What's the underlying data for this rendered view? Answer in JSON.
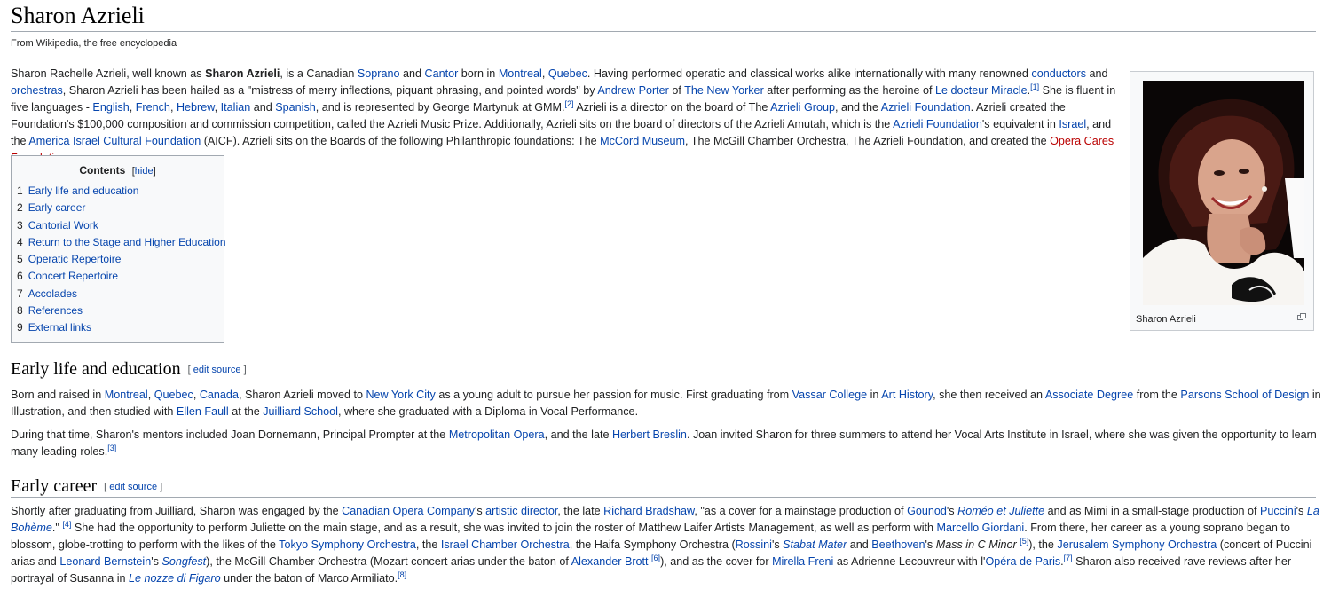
{
  "title": "Sharon Azrieli",
  "tagline": "From Wikipedia, the free encyclopedia",
  "infobox": {
    "caption": "Sharon Azrieli",
    "enlarge_icon": "magnify-clip-icon"
  },
  "toc": {
    "title": "Contents",
    "hide_label": "hide",
    "items": [
      {
        "num": "1",
        "label": "Early life and education"
      },
      {
        "num": "2",
        "label": "Early career"
      },
      {
        "num": "3",
        "label": "Cantorial Work"
      },
      {
        "num": "4",
        "label": "Return to the Stage and Higher Education"
      },
      {
        "num": "5",
        "label": "Operatic Repertoire"
      },
      {
        "num": "6",
        "label": "Concert Repertoire"
      },
      {
        "num": "7",
        "label": "Accolades"
      },
      {
        "num": "8",
        "label": "References"
      },
      {
        "num": "9",
        "label": "External links"
      }
    ]
  },
  "intro": {
    "t1": "Sharon Rachelle Azrieli, well known as ",
    "bold_name": "Sharon Azrieli",
    "t2": ", is a Canadian ",
    "l_soprano": "Soprano",
    "t3": " and ",
    "l_cantor": "Cantor",
    "t4": " born in ",
    "l_montreal": "Montreal",
    "t5": ", ",
    "l_quebec": "Quebec",
    "t6": ". Having performed operatic and classical works alike internationally with many renowned ",
    "l_conductors": "conductors",
    "t7": " and ",
    "l_orchestras": "orchestras",
    "t8": ", Sharon Azrieli has been hailed as a \"mistress of merry inflections, piquant phrasing, and pointed words\" by ",
    "l_porter": "Andrew Porter",
    "t9": " of ",
    "l_newyorker": "The New Yorker",
    "t10": " after performing as the heroine of ",
    "l_ledocteur": "Le docteur Miracle",
    "t11": ".",
    "ref1": "[1]",
    "t12": " She is fluent in five languages - ",
    "l_english": "English",
    "t13": ", ",
    "l_french": "French",
    "t14": ", ",
    "l_hebrew": "Hebrew",
    "t15": ", ",
    "l_italian": "Italian",
    "t16": " and ",
    "l_spanish": "Spanish",
    "t17": ", and is represented by George Martynuk at GMM.",
    "ref2": "[2]",
    "t18": " Azrieli is a director on the board of The ",
    "l_group": "Azrieli Group",
    "t19": ", and the ",
    "l_foundation": "Azrieli Foundation",
    "t20": ". Azrieli created the Foundation's $100,000 composition and commission competition, called the Azrieli Music Prize. Additionally, Azrieli sits on the board of directors of the Azrieli Amutah, which is the ",
    "l_foundation2": "Azrieli Foundation",
    "t21": "'s equivalent in ",
    "l_israel": "Israel",
    "t22": ", and the ",
    "l_aicf": "America Israel Cultural Foundation",
    "t23": " (AICF). Azrieli sits on the Boards of the following Philanthropic foundations: The ",
    "l_mccord": "McCord Museum",
    "t24": ", The McGill Chamber Orchestra, The Azrieli Foundation, and created the ",
    "l_operacares": "Opera Cares Foundation",
    "t25": "."
  },
  "sec1": {
    "heading": "Early life and education",
    "edit_open": "[ ",
    "edit_label": "edit source",
    "edit_close": " ]",
    "p1": {
      "t1": "Born and raised in ",
      "l_montreal": "Montreal",
      "t2": ", ",
      "l_quebec": "Quebec",
      "t3": ", ",
      "l_canada": "Canada",
      "t4": ", Sharon Azrieli moved to ",
      "l_nyc": "New York City",
      "t5": " as a young adult to pursue her passion for music. First graduating from ",
      "l_vassar": "Vassar College",
      "t6": " in ",
      "l_arthistory": "Art History",
      "t7": ", she then received an ",
      "l_assoc": "Associate Degree",
      "t8": " from the ",
      "l_parsons": "Parsons School of Design",
      "t9": " in Illustration, and then studied with ",
      "l_faull": "Ellen Faull",
      "t10": " at the ",
      "l_juilliard": "Juilliard School",
      "t11": ", where she graduated with a Diploma in Vocal Performance."
    },
    "p2": {
      "t1": "During that time, Sharon's mentors included Joan Dornemann, Principal Prompter at the ",
      "l_met": "Metropolitan Opera",
      "t2": ", and the late ",
      "l_breslin": "Herbert Breslin",
      "t3": ". Joan invited Sharon for three summers to attend her Vocal Arts Institute in Israel, where she was given the opportunity to learn many leading roles.",
      "ref3": "[3]"
    }
  },
  "sec2": {
    "heading": "Early career",
    "edit_open": "[ ",
    "edit_label": "edit source",
    "edit_close": " ]",
    "p1": {
      "t1": "Shortly after graduating from Juilliard, Sharon was engaged by the ",
      "l_coc": "Canadian Opera Company",
      "t2": "'s ",
      "l_artdir": "artistic director",
      "t3": ", the late ",
      "l_bradshaw": "Richard Bradshaw",
      "t4": ", \"as a cover for a mainstage production of ",
      "l_gounod": "Gounod",
      "t5": "'s ",
      "l_romeo": "Roméo et Juliette",
      "t6": " and as Mimi in a small-stage production of ",
      "l_puccini": "Puccini",
      "t7": "'s ",
      "l_boheme": "La Bohème",
      "t8": ".\" ",
      "ref4": "[4]",
      "t9": " She had the opportunity to perform Juliette on the main stage, and as a result, she was invited to join the roster of Matthew Laifer Artists Management, as well as perform with ",
      "l_giordani": "Marcello Giordani",
      "t10": ". From there, her career as a young soprano began to blossom, globe-trotting to perform with the likes of the ",
      "l_tokyo": "Tokyo Symphony Orchestra",
      "t11": ", the ",
      "l_icho": "Israel Chamber Orchestra",
      "t12": ", the Haifa Symphony Orchestra (",
      "l_rossini": "Rossini",
      "t13": "'s ",
      "l_stabat": "Stabat Mater",
      "t14": " and ",
      "l_beethoven": "Beethoven",
      "t15": "'s ",
      "mass": "Mass in C Minor",
      "t16": " ",
      "ref5": "[5]",
      "t17": "), the ",
      "l_jso": "Jerusalem Symphony Orchestra",
      "t18": " (concert of Puccini arias and ",
      "l_bernstein": "Leonard Bernstein",
      "t19": "'s ",
      "l_songfest": "Songfest",
      "t20": "), the McGill Chamber Orchestra (Mozart concert arias under the baton of ",
      "l_brott": "Alexander Brott",
      "t21": " ",
      "ref6": "[6]",
      "t22": "), and as the cover for ",
      "l_freni": "Mirella Freni",
      "t23": " as Adrienne Lecouvreur with l'",
      "l_opera": "Opéra de Paris",
      "t24": ".",
      "ref7": "[7]",
      "t25": " Sharon also received rave reviews after her portrayal of Susanna in ",
      "l_figaro": "Le nozze di Figaro",
      "t26": " under the baton of Marco Armiliato.",
      "ref8": "[8]"
    }
  }
}
